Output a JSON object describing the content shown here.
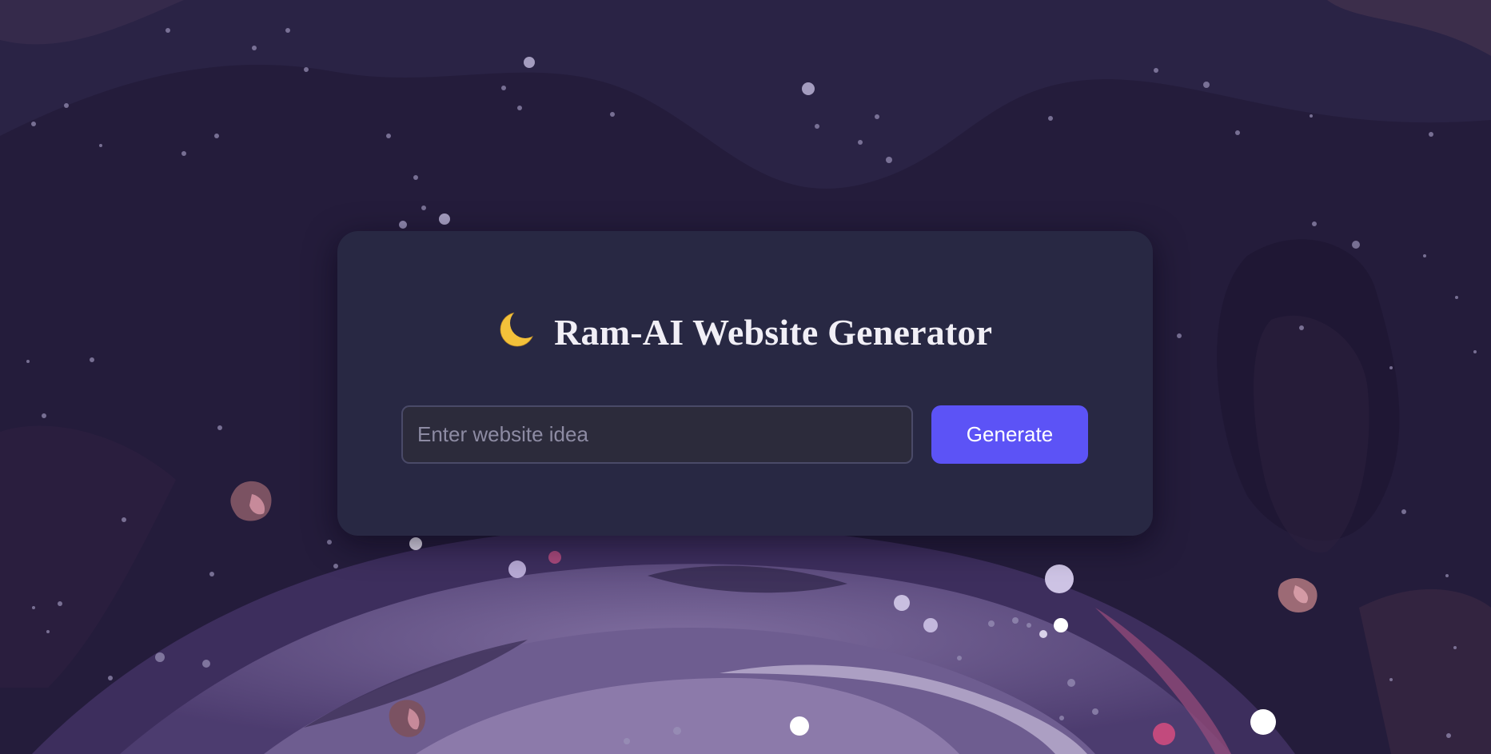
{
  "page": {
    "title": "Ram-AI Website Generator",
    "title_icon": "crescent-moon-icon"
  },
  "form": {
    "input_value": "",
    "input_placeholder": "Enter website idea",
    "generate_label": "Generate"
  },
  "colors": {
    "background": "#231b3a",
    "card": "#282843",
    "accent": "#5c53f6",
    "input_background": "#2c2b3b",
    "title_text": "#f1eff6"
  }
}
